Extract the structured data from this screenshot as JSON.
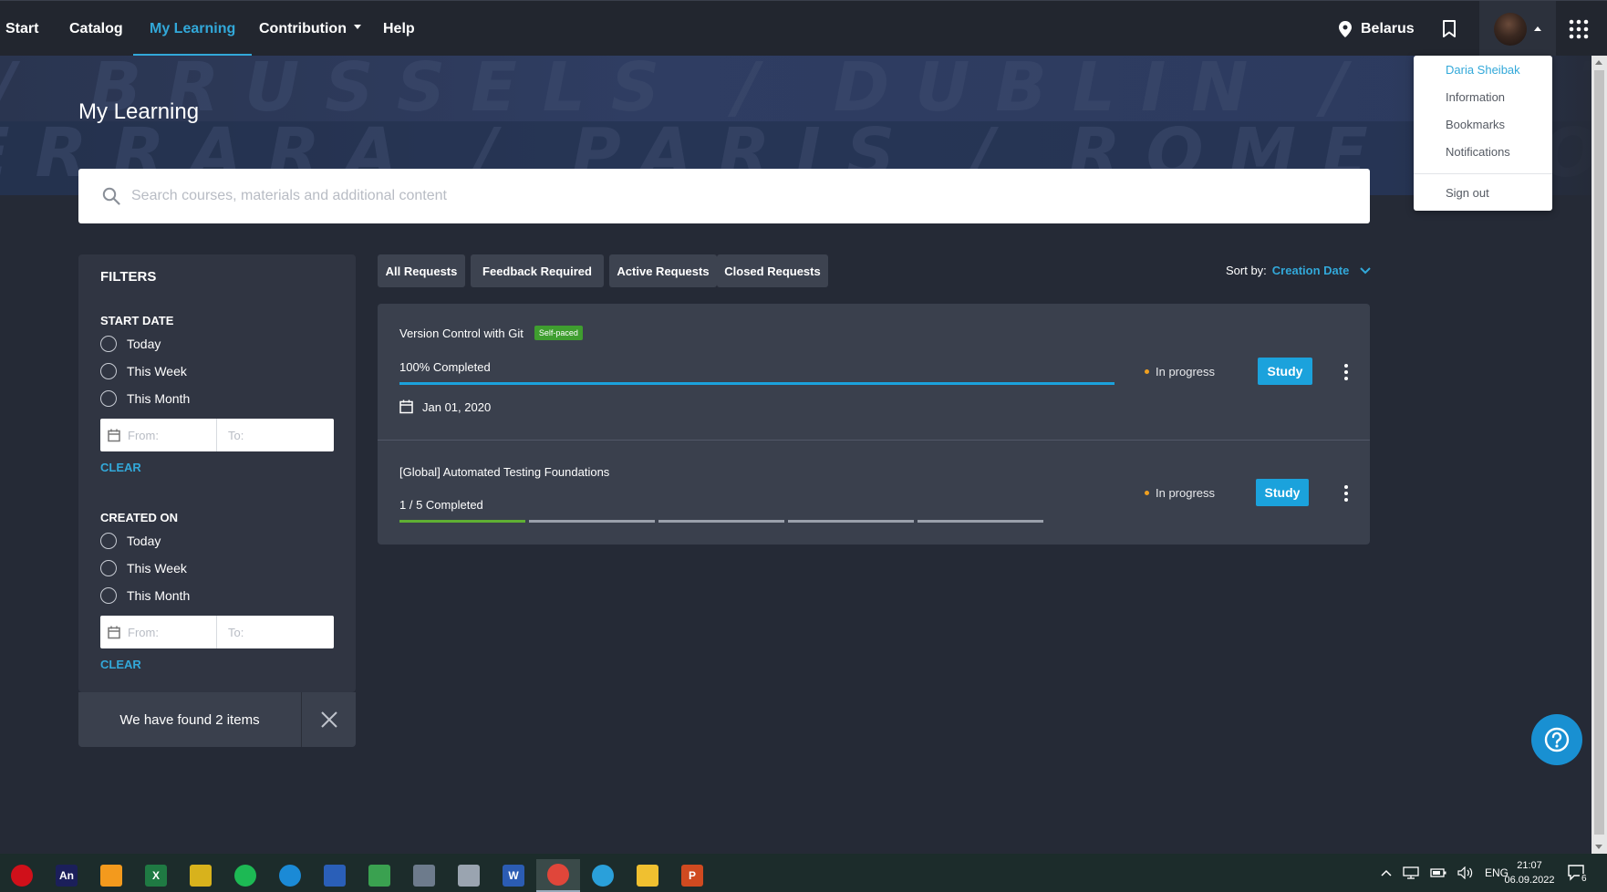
{
  "nav": {
    "items": [
      {
        "label": "Start"
      },
      {
        "label": "Catalog"
      },
      {
        "label": "My Learning"
      },
      {
        "label": "Contribution"
      },
      {
        "label": "Help"
      }
    ],
    "location": "Belarus"
  },
  "hero": {
    "line1": "/ BRUSSELS / DUBLIN / POTSDAM / BRUSSELS",
    "line2": "ERRARA / PARIS / ROME / OSLO / FERRARA / PARIS",
    "title": "My Learning"
  },
  "search": {
    "placeholder": "Search courses, materials and additional content"
  },
  "filters": {
    "title": "FILTERS",
    "start_date": {
      "label": "START DATE",
      "options": [
        "Today",
        "This Week",
        "This Month"
      ],
      "from_placeholder": "From:",
      "to_placeholder": "To:",
      "clear": "CLEAR"
    },
    "created_on": {
      "label": "CREATED ON",
      "options": [
        "Today",
        "This Week",
        "This Month"
      ],
      "from_placeholder": "From:",
      "to_placeholder": "To:",
      "clear": "CLEAR"
    },
    "found_text": "We have found 2 items"
  },
  "tabs": [
    "All Requests",
    "Feedback Required",
    "Active Requests",
    "Closed Requests"
  ],
  "sort": {
    "label": "Sort by:",
    "value": "Creation Date"
  },
  "items": [
    {
      "title": "Version Control with Git",
      "badge": "Self-paced",
      "progress_label": "100% Completed",
      "progress": 1.0,
      "date": "Jan 01, 2020",
      "status": "In progress",
      "action": "Study"
    },
    {
      "title": "[Global] Automated Testing Foundations",
      "progress_label": "1 / 5 Completed",
      "segments_done": 1,
      "segments_total": 5,
      "status": "In progress",
      "action": "Study"
    }
  ],
  "profile_menu": {
    "name": "Daria Sheibak",
    "items": [
      "Information",
      "Bookmarks",
      "Notifications"
    ],
    "sign_out": "Sign out"
  },
  "taskbar": {
    "lang": "ENG",
    "time": "21:07",
    "date": "06.09.2022",
    "notifications": "6",
    "apps": [
      {
        "name": "opera",
        "color": "#d0101a",
        "glyph": ""
      },
      {
        "name": "animate",
        "color": "#1b1f5a",
        "glyph": "An"
      },
      {
        "name": "app-orange",
        "color": "#f39a1d",
        "glyph": ""
      },
      {
        "name": "excel",
        "color": "#1f7a43",
        "glyph": "X"
      },
      {
        "name": "app-yellow",
        "color": "#d8b21c",
        "glyph": ""
      },
      {
        "name": "spotify",
        "color": "#1db954",
        "glyph": ""
      },
      {
        "name": "edge",
        "color": "#1b8ad6",
        "glyph": ""
      },
      {
        "name": "app-blue",
        "color": "#2a5fb8",
        "glyph": ""
      },
      {
        "name": "app-green",
        "color": "#3aa150",
        "glyph": ""
      },
      {
        "name": "app-stack",
        "color": "#6d7b8c",
        "glyph": ""
      },
      {
        "name": "app-gray",
        "color": "#9aa4b0",
        "glyph": ""
      },
      {
        "name": "word",
        "color": "#2b5cb3",
        "glyph": "W"
      },
      {
        "name": "chrome",
        "color": "#e0463a",
        "glyph": ""
      },
      {
        "name": "telegram",
        "color": "#2aa0da",
        "glyph": ""
      },
      {
        "name": "explorer",
        "color": "#f0c030",
        "glyph": ""
      },
      {
        "name": "powerpoint",
        "color": "#d04a20",
        "glyph": "P"
      }
    ]
  },
  "colors": {
    "accent": "#32a8d9",
    "background": "#252a36",
    "study_button": "#1ba2dc",
    "badge": "#3f9e2f",
    "status_dot": "#f0a020",
    "progress_complete": "#1ba2dc",
    "progress_segment_done": "#5fb033"
  }
}
